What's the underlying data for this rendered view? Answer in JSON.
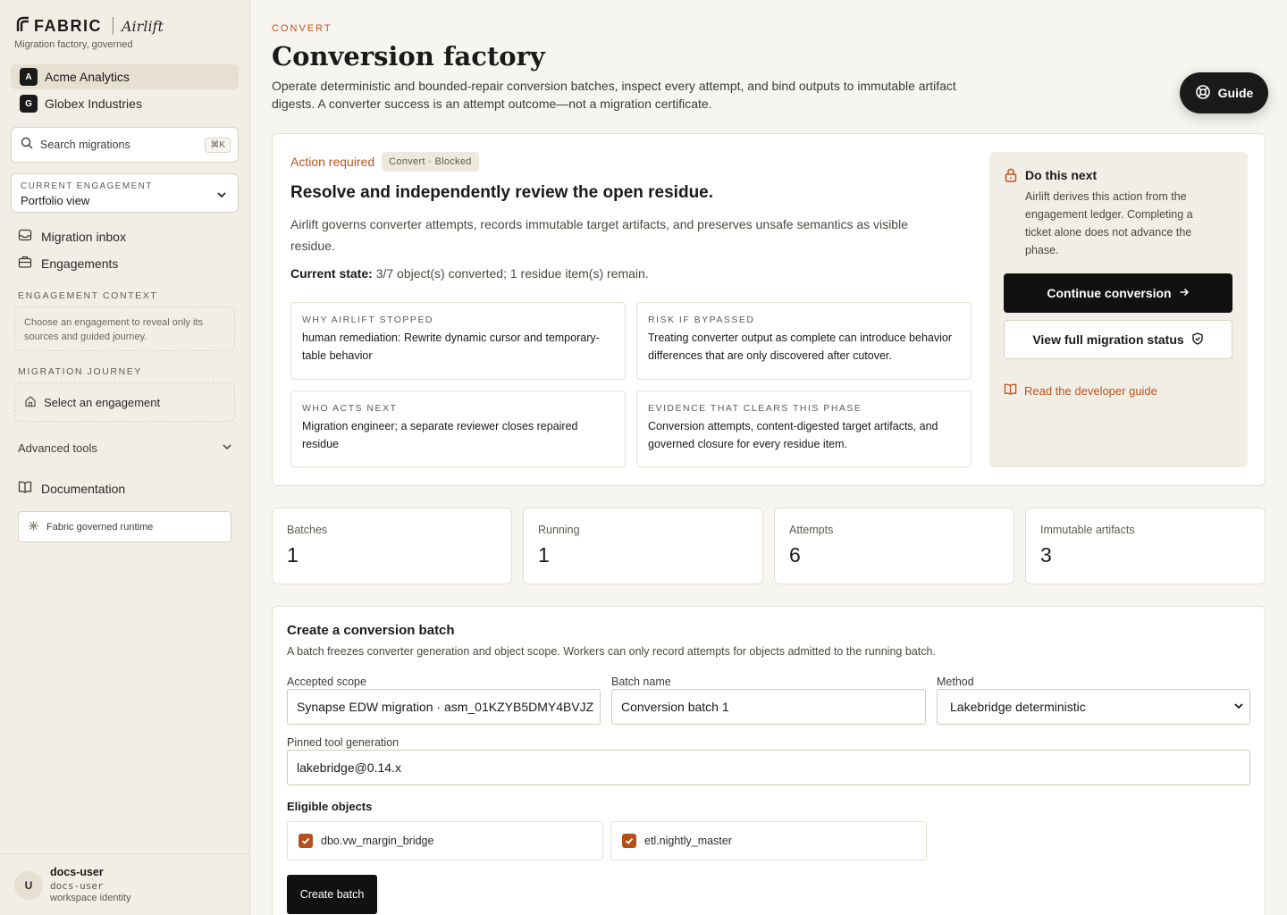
{
  "brand": {
    "name": "FABRIC",
    "product": "Airlift",
    "tagline": "Migration factory, governed"
  },
  "orgs": [
    {
      "badge": "A",
      "name": "Acme Analytics",
      "active": true
    },
    {
      "badge": "G",
      "name": "Globex Industries",
      "active": false
    }
  ],
  "search": {
    "placeholder": "Search migrations",
    "shortcut": "⌘K"
  },
  "engagement": {
    "label": "CURRENT ENGAGEMENT",
    "value": "Portfolio view"
  },
  "nav": [
    {
      "label": "Migration inbox",
      "icon": "inbox-icon"
    },
    {
      "label": "Engagements",
      "icon": "briefcase-icon"
    }
  ],
  "context": {
    "label": "ENGAGEMENT CONTEXT",
    "text": "Choose an engagement to reveal only its sources and guided journey."
  },
  "journey": {
    "label": "MIGRATION JOURNEY",
    "item": "Select an engagement"
  },
  "advanced": {
    "label": "Advanced tools"
  },
  "documentation": {
    "label": "Documentation"
  },
  "runtime": {
    "label": "Fabric governed runtime"
  },
  "user": {
    "initial": "U",
    "name": "docs-user",
    "handle": "docs-user",
    "identity": "workspace identity"
  },
  "page": {
    "eyebrow": "CONVERT",
    "title": "Conversion factory",
    "description": "Operate deterministic and bounded-repair conversion batches, inspect every attempt, and bind outputs to immutable artifact digests. A converter success is an attempt outcome—not a migration certificate.",
    "guide_label": "Guide"
  },
  "action": {
    "label": "Action required",
    "pill": "Convert · Blocked",
    "heading": "Resolve and independently review the open residue.",
    "description": "Airlift governs converter attempts, records immutable target artifacts, and preserves unsafe semantics as visible residue.",
    "state_label": "Current state:",
    "state_value": "3/7 object(s) converted; 1 residue item(s) remain.",
    "boxes": [
      {
        "label": "WHY AIRLIFT STOPPED",
        "text": "human remediation: Rewrite dynamic cursor and temporary-table behavior"
      },
      {
        "label": "RISK IF BYPASSED",
        "text": "Treating converter output as complete can introduce behavior differences that are only discovered after cutover."
      },
      {
        "label": "WHO ACTS NEXT",
        "text": "Migration engineer; a separate reviewer closes repaired residue"
      },
      {
        "label": "EVIDENCE THAT CLEARS THIS PHASE",
        "text": "Conversion attempts, content-digested target artifacts, and governed closure for every residue item."
      }
    ],
    "next": {
      "title": "Do this next",
      "description": "Airlift derives this action from the engagement ledger. Completing a ticket alone does not advance the phase.",
      "primary": "Continue conversion",
      "secondary": "View full migration status",
      "link": "Read the developer guide"
    }
  },
  "stats": [
    {
      "label": "Batches",
      "value": "1"
    },
    {
      "label": "Running",
      "value": "1"
    },
    {
      "label": "Attempts",
      "value": "6"
    },
    {
      "label": "Immutable artifacts",
      "value": "3"
    }
  ],
  "batch": {
    "title": "Create a conversion batch",
    "description": "A batch freezes converter generation and object scope. Workers can only record attempts for objects admitted to the running batch.",
    "scope_label": "Accepted scope",
    "scope_value": "Synapse EDW migration · asm_01KZYB5DMY4BVJZ",
    "name_label": "Batch name",
    "name_value": "Conversion batch 1",
    "method_label": "Method",
    "method_value": "Lakebridge deterministic",
    "tool_label": "Pinned tool generation",
    "tool_value": "lakebridge@0.14.x",
    "eligible_label": "Eligible objects",
    "objects": [
      {
        "name": "dbo.vw_margin_bridge",
        "checked": true
      },
      {
        "name": "etl.nightly_master",
        "checked": true
      }
    ],
    "create_label": "Create batch"
  },
  "colors": {
    "accent": "#c0521a",
    "dark": "#111111",
    "sidebar": "#f1eee6",
    "page": "#f7f5f0"
  }
}
